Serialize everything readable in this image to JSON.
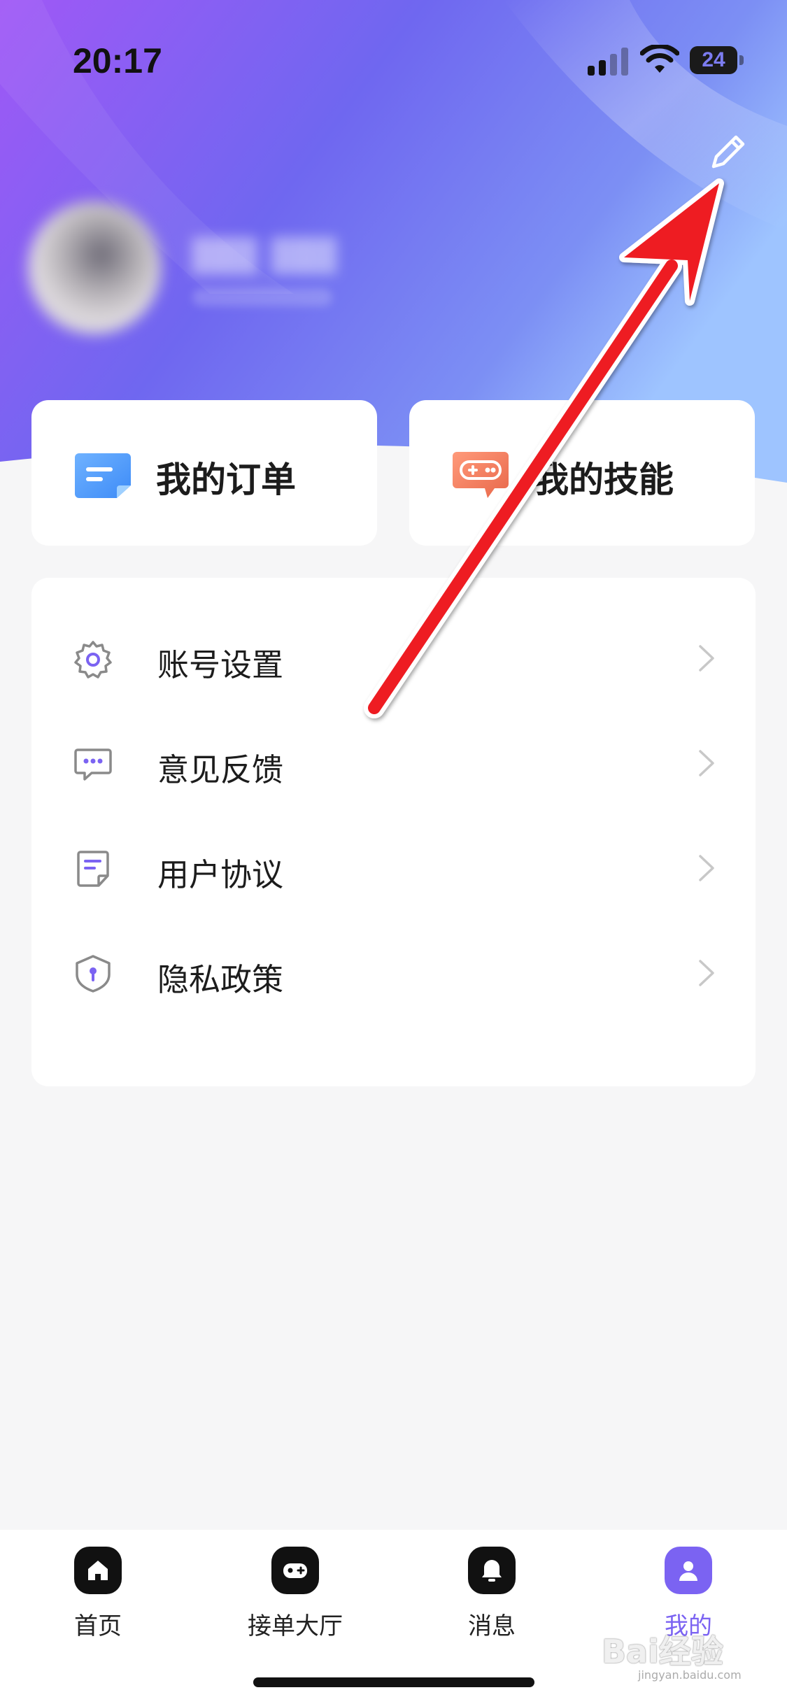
{
  "status_bar": {
    "time": "20:17",
    "battery": "24"
  },
  "quick_actions": [
    {
      "label": "我的订单",
      "icon": "order-icon"
    },
    {
      "label": "我的技能",
      "icon": "gamepad-icon"
    }
  ],
  "menu": [
    {
      "label": "账号设置",
      "icon": "gear-icon"
    },
    {
      "label": "意见反馈",
      "icon": "feedback-icon"
    },
    {
      "label": "用户协议",
      "icon": "agreement-icon"
    },
    {
      "label": "隐私政策",
      "icon": "privacy-shield-icon"
    }
  ],
  "tabs": [
    {
      "label": "首页",
      "icon": "home-icon"
    },
    {
      "label": "接单大厅",
      "icon": "gamepad-icon"
    },
    {
      "label": "消息",
      "icon": "bell-icon"
    },
    {
      "label": "我的",
      "icon": "user-icon",
      "active": true
    }
  ],
  "colors": {
    "accent": "#7b63f2",
    "header_gradient_start": "#9b5cf6",
    "header_gradient_end": "#8fb6ff",
    "annotation_arrow": "#ee1c24"
  },
  "watermark": {
    "brand": "Bai经验",
    "url": "jingyan.baidu.com"
  }
}
